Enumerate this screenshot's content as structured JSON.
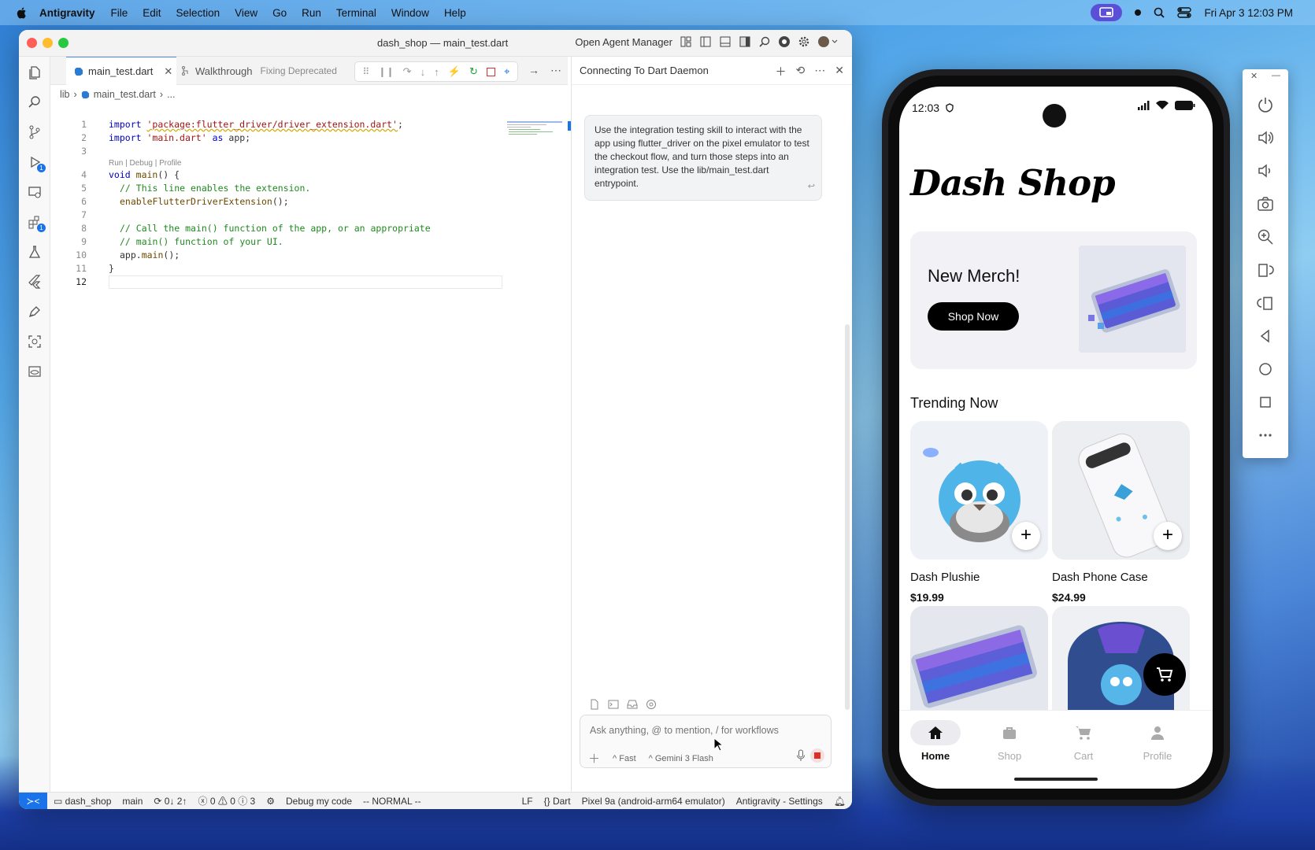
{
  "menubar": {
    "app_name": "Antigravity",
    "items": [
      "File",
      "Edit",
      "Selection",
      "View",
      "Go",
      "Run",
      "Terminal",
      "Window",
      "Help"
    ],
    "datetime": "Fri Apr 3  12:03 PM"
  },
  "window": {
    "title": "dash_shop — main_test.dart",
    "open_agent_manager": "Open Agent Manager"
  },
  "tabs": {
    "active": "main_test.dart",
    "second": "Walkthrough",
    "second_sub": "Fixing Deprecated"
  },
  "breadcrumb": {
    "folder": "lib",
    "file": "main_test.dart",
    "more": "..."
  },
  "editor": {
    "codelens": "Run | Debug | Profile",
    "lines": [
      {
        "n": "1"
      },
      {
        "n": "2"
      },
      {
        "n": "3"
      },
      {
        "n": "4"
      },
      {
        "n": "5"
      },
      {
        "n": "6"
      },
      {
        "n": "7"
      },
      {
        "n": "8"
      },
      {
        "n": "9"
      },
      {
        "n": "10"
      },
      {
        "n": "11"
      },
      {
        "n": "12"
      }
    ],
    "tokens": {
      "l1_kw": "import",
      "l1_str": "'package:flutter_driver/driver_extension.dart'",
      "l1_end": ";",
      "l2_kw": "import",
      "l2_str": "'main.dart'",
      "l2_kw2": "as",
      "l2_end": "app;",
      "l4_kw": "void",
      "l4_fn": "main",
      "l4_end": "() {",
      "l5_cm": "// This line enables the extension.",
      "l6_fn": "enableFlutterDriverExtension",
      "l6_end": "();",
      "l8_cm": "// Call the main() function of the app, or an appropriate",
      "l9_cm": "// main() function of your UI.",
      "l10_a": "app.",
      "l10_fn": "main",
      "l10_end": "();",
      "l11": "}"
    }
  },
  "agent": {
    "title": "Connecting To Dart Daemon",
    "message": "Use the integration testing skill to interact with the app using flutter_driver on the pixel emulator to test the checkout flow, and turn those steps into an integration test. Use the lib/main_test.dart entrypoint.",
    "input_placeholder": "Ask anything, @ to mention, / for workflows",
    "mode": "Fast",
    "model": "Gemini 3 Flash"
  },
  "status": {
    "project": "dash_shop",
    "branch": "main",
    "sync": "0↓ 2↑",
    "errors": "0",
    "warnings": "0",
    "info": "3",
    "debug": "Debug my code",
    "vim_mode": "-- NORMAL --",
    "eol": "LF",
    "language": "Dart",
    "device": "Pixel 9a (android-arm64 emulator)",
    "settings": "Antigravity - Settings"
  },
  "phone": {
    "time": "12:03",
    "app_title": "Dash Shop",
    "banner_title": "New Merch!",
    "banner_button": "Shop Now",
    "section_title": "Trending Now",
    "products": [
      {
        "name": "Dash Plushie",
        "price": "$19.99"
      },
      {
        "name": "Dash Phone Case",
        "price": "$24.99"
      }
    ],
    "nav": [
      {
        "label": "Home",
        "icon": "home-icon"
      },
      {
        "label": "Shop",
        "icon": "shopping-bag-icon"
      },
      {
        "label": "Cart",
        "icon": "cart-icon"
      },
      {
        "label": "Profile",
        "icon": "person-icon"
      }
    ]
  },
  "colors": {
    "accent": "#1a73e8",
    "stop": "#d93025",
    "button_dark": "#000000"
  }
}
